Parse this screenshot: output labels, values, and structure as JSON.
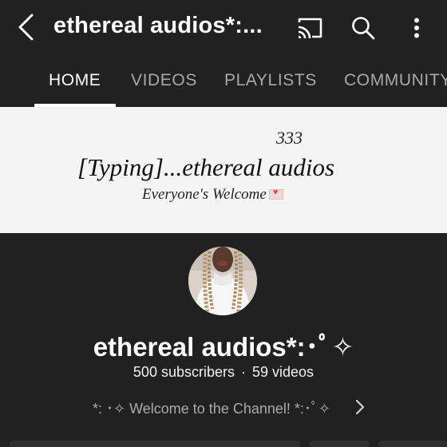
{
  "header": {
    "title": "ethereal audios*:...",
    "icons": [
      "back-arrow-icon",
      "cast-icon",
      "search-icon",
      "more-vert-icon"
    ]
  },
  "tabs": [
    {
      "label": "HOME",
      "active": true
    },
    {
      "label": "VIDEOS",
      "active": false
    },
    {
      "label": "PLAYLISTS",
      "active": false
    },
    {
      "label": "COMMUNITY",
      "active": false
    }
  ],
  "banner": {
    "number": "333",
    "main_text": "[Typing]...ethereal audios",
    "sub_text": "Everyone's Welcome"
  },
  "channel": {
    "name": "ethereal audios*:･ﾟ✧",
    "subscribers": "500 subscribers",
    "videos": "59 videos",
    "separator": "·",
    "description": "*: ･✧ Welcome to the Channel! *:･ﾟ✧"
  },
  "colors": {
    "background": "#212121",
    "banner_bg": "#f4f4f4",
    "inactive_tab": "#a9a9a9",
    "muted_text": "#aaaaaa"
  }
}
